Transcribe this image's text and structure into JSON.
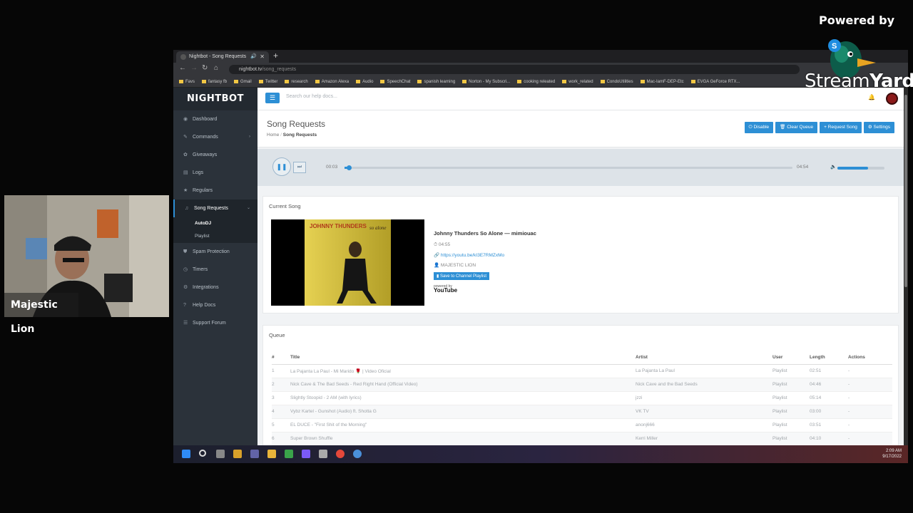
{
  "overlay": {
    "powered_by": "Powered by",
    "brand_a": "Stream",
    "brand_b": "Yard",
    "cam_name": "Majestic Lion"
  },
  "browser": {
    "tab_title": "Nightbot - Song Requests",
    "url_host": "nightbot.tv",
    "url_path": "/song_requests",
    "bookmarks": [
      "Favs",
      "fantasy fb",
      "Gmail",
      "Twitter",
      "research",
      "Amazon Alexa",
      "Audio",
      "SpeechChat",
      "spanish learning",
      "Norton - My Subscri...",
      "cooking releated",
      "work_related",
      "CondoUtilities",
      "Mac-IamF-DEP-Etc",
      "EVGA GeForce RTX..."
    ]
  },
  "sidebar": {
    "brand": "NIGHTBOT",
    "items": [
      {
        "label": "Dashboard",
        "icon": "dashboard-icon",
        "glyph": "◉"
      },
      {
        "label": "Commands",
        "icon": "commands-icon",
        "glyph": "✎",
        "chevron": "›"
      },
      {
        "label": "Giveaways",
        "icon": "gift-icon",
        "glyph": "✿"
      },
      {
        "label": "Logs",
        "icon": "logs-icon",
        "glyph": "▤"
      },
      {
        "label": "Regulars",
        "icon": "star-icon",
        "glyph": "★"
      }
    ],
    "active": {
      "label": "Song Requests",
      "icon": "music-icon",
      "glyph": "♫",
      "chevron": "⌄"
    },
    "sub_items": [
      "AutoDJ",
      "Playlist"
    ],
    "items_after": [
      {
        "label": "Spam Protection",
        "icon": "shield-icon",
        "glyph": "⛊"
      },
      {
        "label": "Timers",
        "icon": "clock-icon",
        "glyph": "◷"
      },
      {
        "label": "Integrations",
        "icon": "integrations-icon",
        "glyph": "⚙"
      },
      {
        "label": "Help Docs",
        "icon": "help-icon",
        "glyph": "?"
      },
      {
        "label": "Support Forum",
        "icon": "forum-icon",
        "glyph": "☰"
      }
    ]
  },
  "topbar": {
    "search_placeholder": "Search our help docs..."
  },
  "header": {
    "title": "Song Requests",
    "crumb_home": "Home",
    "crumb_current": "Song Requests",
    "buttons": [
      "⏻ Disable",
      "🗑 Clear Queue",
      "+ Request Song",
      "⚙ Settings"
    ]
  },
  "player": {
    "current_time": "00:03",
    "total_time": "04:54",
    "progress": 0.01,
    "volume": 0.65
  },
  "current_song": {
    "heading": "Current Song",
    "cover_text_top": "JOHNNY THUNDERS",
    "cover_text_script": "so alone",
    "title": "Johnny Thunders So Alone — mimiouac",
    "length": "⏱ 04:55",
    "link": "🔗 https://youtu.be/kI3E7RMZxMo",
    "user": "👤 MAJESTIC LION",
    "save_label": "▮ Save to Channel Playlist",
    "powered_small": "powered by",
    "yt_label": "YouTube"
  },
  "queue": {
    "heading": "Queue",
    "columns": [
      "#",
      "Title",
      "Artist",
      "User",
      "Length",
      "Actions"
    ],
    "rows": [
      [
        "1",
        "La Pajanta La Paul - Mi Marido 🌹 | Video Oficial",
        "La Pajanta La Paul",
        "Playlist",
        "02:51",
        "-"
      ],
      [
        "2",
        "Nick Cave & The Bad Seeds - Red Right Hand (Official Video)",
        "Nick Cave and the Bad Seeds",
        "Playlist",
        "04:46",
        "-"
      ],
      [
        "3",
        "Slightly Stoopid - 2 AM (with lyrics)",
        "jzzi",
        "Playlist",
        "05:14",
        "-"
      ],
      [
        "4",
        "Vybz Kartel - Gunshot (Audio) ft. Shotta G",
        "VK TV",
        "Playlist",
        "03:00",
        "-"
      ],
      [
        "5",
        "EL DUCE - \"First Shit of the Morning\"",
        "anonj666",
        "Playlist",
        "03:51",
        "-"
      ],
      [
        "6",
        "Super Brown Shuffle",
        "Kerri Miller",
        "Playlist",
        "04:10",
        "-"
      ]
    ]
  },
  "taskbar": {
    "time": "2:09 AM",
    "date": "9/17/2022"
  }
}
